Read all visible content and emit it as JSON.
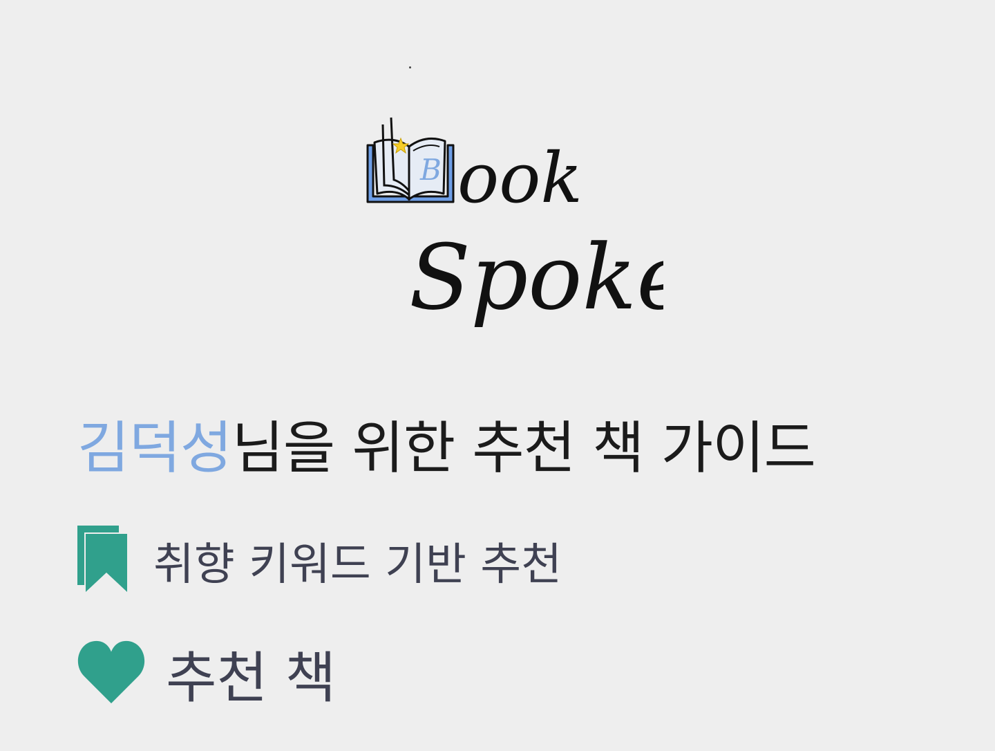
{
  "logo": {
    "line1_initial": "B",
    "line1_rest": "ook",
    "line2": "Spoke"
  },
  "headline": {
    "user_name": "김덕성",
    "suffix": "님을 위한 추천 책 가이드"
  },
  "keyword_section": {
    "icon": "bookmark-icon",
    "label": "취향 키워드 기반 추천"
  },
  "books_section": {
    "icon": "heart-icon",
    "label": "추천 책"
  },
  "colors": {
    "background": "#eeeeee",
    "accent_blue": "#7fa8e0",
    "accent_teal": "#30a08c",
    "heading_text": "#1b1b1b",
    "section_text": "#3f4152"
  }
}
